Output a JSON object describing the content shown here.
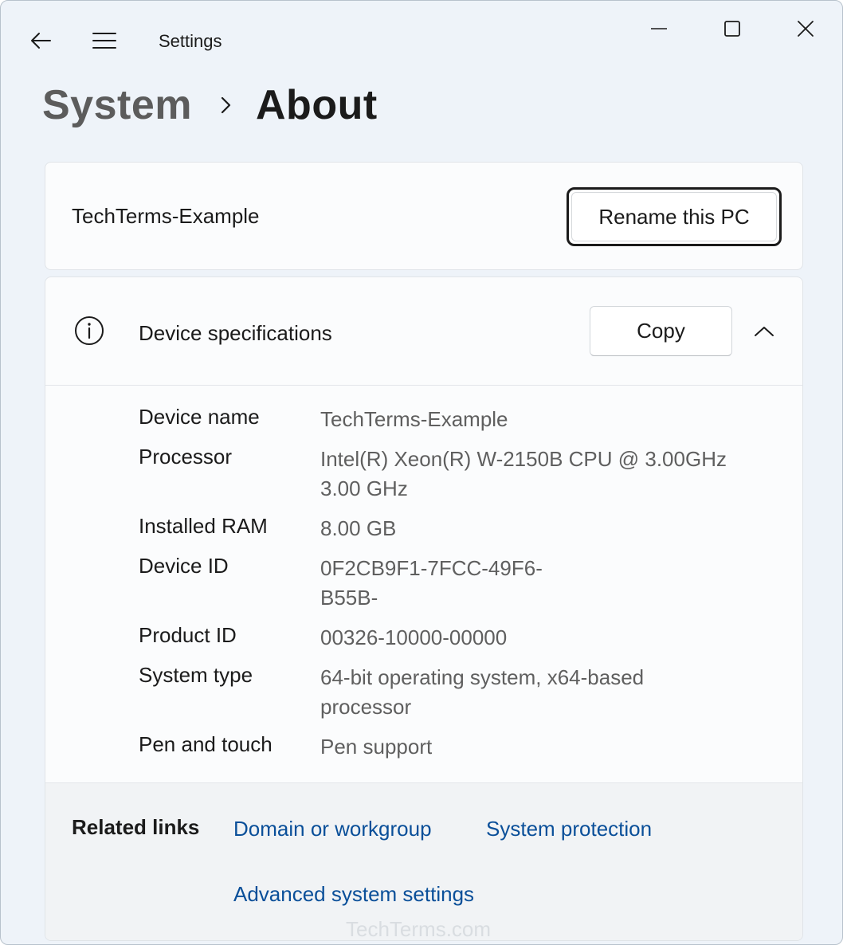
{
  "window": {
    "app_title": "Settings",
    "icons": {
      "back": "back-arrow-icon",
      "menu": "hamburger-menu-icon",
      "minimize": "minimize-icon",
      "maximize": "maximize-icon",
      "close": "close-icon"
    }
  },
  "breadcrumb": {
    "parent": "System",
    "separator_icon": "chevron-right-icon",
    "current": "About"
  },
  "pc_card": {
    "name": "TechTerms-Example",
    "rename_label": "Rename this PC"
  },
  "device_specs": {
    "title": "Device specifications",
    "info_icon": "info-icon",
    "copy_label": "Copy",
    "collapse_icon": "chevron-up-icon",
    "rows": [
      {
        "label": "Device name",
        "value": "TechTerms-Example"
      },
      {
        "label": "Processor",
        "value": "Intel(R) Xeon(R) W-2150B CPU @ 3.00GHz 3.00 GHz"
      },
      {
        "label": "Installed RAM",
        "value": "8.00 GB"
      },
      {
        "label": "Device ID",
        "value": "0F2CB9F1-7FCC-49F6-B55B-"
      },
      {
        "label": "Product ID",
        "value": "00326-10000-00000"
      },
      {
        "label": "System type",
        "value": "64-bit operating system, x64-based processor"
      },
      {
        "label": "Pen and touch",
        "value": "Pen support"
      }
    ]
  },
  "related_links": {
    "title": "Related links",
    "links": [
      "Domain or workgroup",
      "System protection",
      "Advanced system settings"
    ]
  },
  "watermark": "TechTerms.com",
  "colors": {
    "link": "#0a4f99",
    "window_bg": "#eef3f9",
    "card_bg": "#fbfcfd",
    "secondary_text": "#5f5f5f"
  }
}
